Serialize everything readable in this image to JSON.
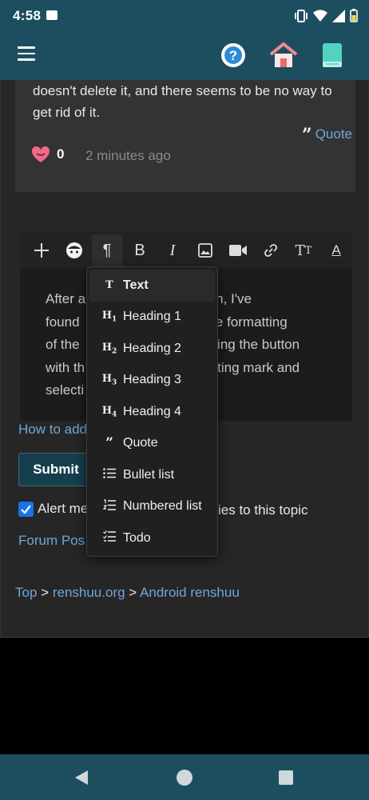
{
  "status_bar": {
    "time": "4:58"
  },
  "post": {
    "text": "doesn't delete it, and there seems to be no way to get rid of it.",
    "quote_label": "Quote",
    "like_count": "0",
    "timestamp": "2 minutes ago"
  },
  "editor": {
    "body_left": "After a",
    "body_line1_right": "entation, I've",
    "body_line2_left": "found",
    "body_line2_right": "e the formatting",
    "body_line3_left": "of the",
    "body_line3_right": "sing the button",
    "body_line4_left": "with th",
    "body_line4_right": "ting mark and",
    "body_line5_left": "selecti"
  },
  "format_menu": {
    "items": [
      {
        "icon": "T",
        "label": "Text"
      },
      {
        "icon": "H1",
        "label": "Heading 1"
      },
      {
        "icon": "H2",
        "label": "Heading 2"
      },
      {
        "icon": "H3",
        "label": "Heading 3"
      },
      {
        "icon": "H4",
        "label": "Heading 4"
      },
      {
        "icon": "99",
        "label": "Quote"
      },
      {
        "icon": "bullet-list-icon",
        "label": "Bullet list"
      },
      {
        "icon": "numbered-list-icon",
        "label": "Numbered list"
      },
      {
        "icon": "todo-icon",
        "label": "Todo"
      }
    ],
    "selected": "Text"
  },
  "links": {
    "how_to": "How to add",
    "submit": "Submit",
    "alert_prefix": "Alert me",
    "alert_suffix": "ies to this topic",
    "forum_posts": "Forum Pos"
  },
  "breadcrumb": {
    "top": "Top",
    "sep": ">",
    "site": "renshuu.org",
    "section": "Android renshuu"
  },
  "colors": {
    "app_bar": "#1d4e5f",
    "background": "#262626",
    "link": "#6fa6d9",
    "accent_checkbox": "#1a73e8"
  }
}
